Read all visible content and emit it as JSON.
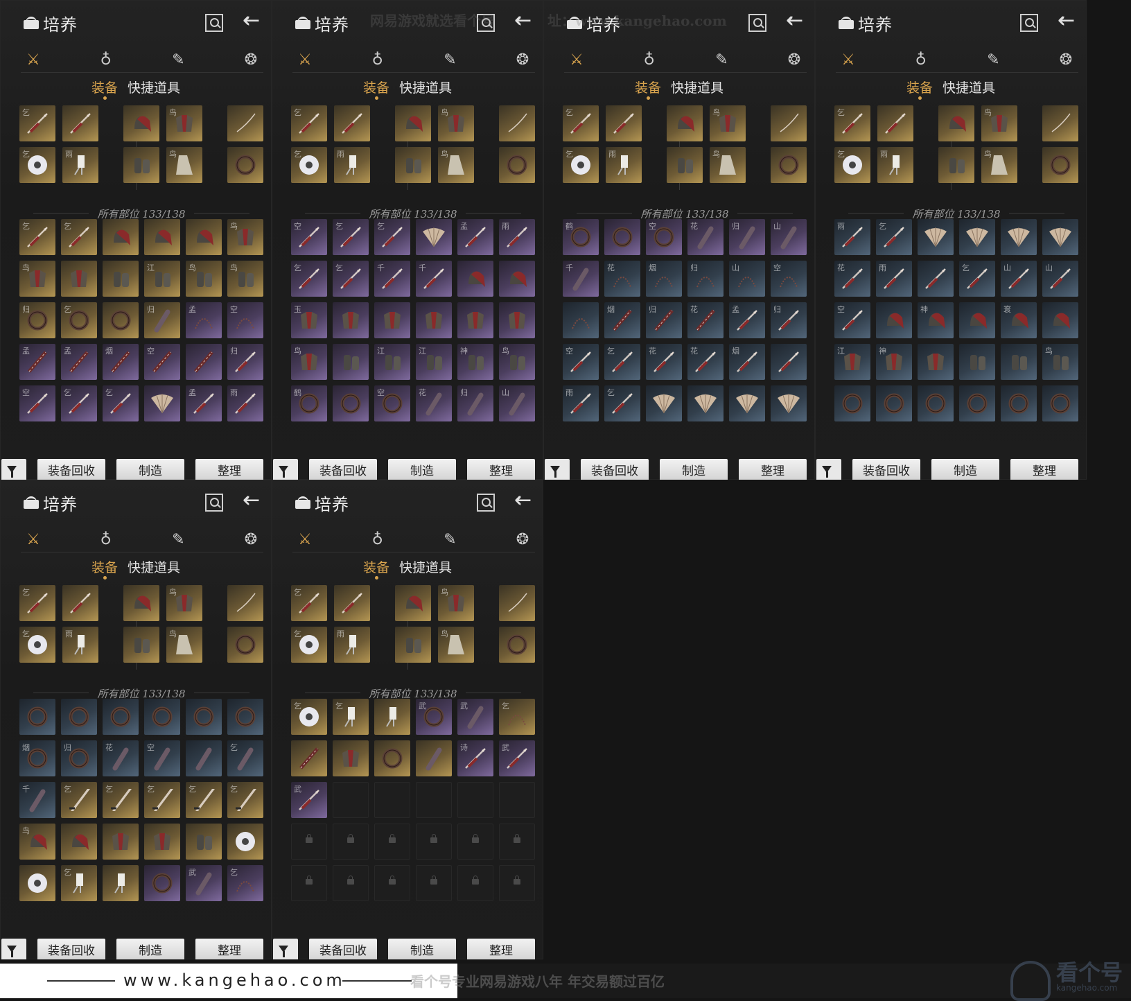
{
  "panel": {
    "title": "培养",
    "categories": [
      {
        "icon": "crossed-swords-icon",
        "glyph": "⚔",
        "active": true
      },
      {
        "icon": "pouch-icon",
        "glyph": "♁",
        "active": false
      },
      {
        "icon": "scroll-icon",
        "glyph": "✎",
        "active": false
      },
      {
        "icon": "skill-orb-icon",
        "glyph": "❂",
        "active": false
      }
    ],
    "tab_equip": "装备",
    "tab_quick": "快捷道具",
    "parts_label": "所有部位 133/138",
    "buttons": {
      "recycle": "装备回收",
      "craft": "制造",
      "arrange": "整理"
    }
  },
  "colors": {
    "accent": "#d9a44e",
    "gold": "#b49653",
    "purple": "#7f6a9e",
    "blue": "#52667a"
  },
  "equipped": [
    {
      "q": "gold",
      "ch": "乞",
      "type": "spear"
    },
    {
      "q": "gold",
      "ch": "",
      "type": "spear"
    },
    {
      "q": "gold",
      "ch": "",
      "type": "helmet"
    },
    {
      "q": "gold",
      "ch": "鸟",
      "type": "armor"
    },
    {
      "q": "gold",
      "ch": "",
      "type": "bow"
    },
    {
      "q": "gold",
      "ch": "乞",
      "type": "disc"
    },
    {
      "q": "gold",
      "ch": "雨",
      "type": "tassel"
    },
    {
      "q": "gold",
      "ch": "",
      "type": "bracer"
    },
    {
      "q": "gold",
      "ch": "鸟",
      "type": "boot"
    },
    {
      "q": "gold",
      "ch": "",
      "type": "ring"
    }
  ],
  "grids": [
    [
      [
        "gold",
        "乞",
        "spear"
      ],
      [
        "gold",
        "乞",
        "spear"
      ],
      [
        "gold",
        "",
        "helmet"
      ],
      [
        "gold",
        "",
        "helmet"
      ],
      [
        "gold",
        "",
        "helmet"
      ],
      [
        "gold",
        "鸟",
        "armor"
      ],
      [
        "gold",
        "鸟",
        "armor"
      ],
      [
        "gold",
        "",
        "armor"
      ],
      [
        "gold",
        "",
        "bracer"
      ],
      [
        "gold",
        "江",
        "bracer"
      ],
      [
        "gold",
        "鸟",
        "bracer"
      ],
      [
        "gold",
        "鸟",
        "bracer"
      ],
      [
        "gold",
        "归",
        "ring"
      ],
      [
        "gold",
        "乞",
        "ring"
      ],
      [
        "gold",
        "",
        "ring"
      ],
      [
        "gold",
        "归",
        "club"
      ],
      [
        "purple",
        "孟",
        "chain"
      ],
      [
        "purple",
        "空",
        "chain"
      ],
      [
        "purple",
        "孟",
        "umbrella"
      ],
      [
        "purple",
        "孟",
        "umbrella"
      ],
      [
        "purple",
        "烟",
        "umbrella"
      ],
      [
        "purple",
        "空",
        "umbrella"
      ],
      [
        "purple",
        "",
        "umbrella"
      ],
      [
        "purple",
        "归",
        "spear"
      ],
      [
        "purple",
        "空",
        "spear"
      ],
      [
        "purple",
        "乞",
        "spear"
      ],
      [
        "purple",
        "乞",
        "spear"
      ],
      [
        "purple",
        "",
        "fan"
      ],
      [
        "purple",
        "孟",
        "spear"
      ],
      [
        "purple",
        "雨",
        "spear"
      ]
    ],
    [
      [
        "purple",
        "空",
        "spear"
      ],
      [
        "purple",
        "乞",
        "spear"
      ],
      [
        "purple",
        "乞",
        "spear"
      ],
      [
        "purple",
        "",
        "fan"
      ],
      [
        "purple",
        "孟",
        "spear"
      ],
      [
        "purple",
        "雨",
        "spear"
      ],
      [
        "purple",
        "乞",
        "spear"
      ],
      [
        "purple",
        "乞",
        "spear"
      ],
      [
        "purple",
        "千",
        "spear"
      ],
      [
        "purple",
        "千",
        "spear"
      ],
      [
        "purple",
        "",
        "helmet"
      ],
      [
        "purple",
        "",
        "helmet"
      ],
      [
        "purple",
        "玉",
        "armor"
      ],
      [
        "purple",
        "",
        "armor"
      ],
      [
        "purple",
        "",
        "armor"
      ],
      [
        "purple",
        "",
        "armor"
      ],
      [
        "purple",
        "",
        "armor"
      ],
      [
        "purple",
        "",
        "armor"
      ],
      [
        "purple",
        "鸟",
        "armor"
      ],
      [
        "purple",
        "",
        "bracer"
      ],
      [
        "purple",
        "江",
        "bracer"
      ],
      [
        "purple",
        "江",
        "bracer"
      ],
      [
        "purple",
        "神",
        "bracer"
      ],
      [
        "purple",
        "鸟",
        "bracer"
      ],
      [
        "purple",
        "鹤",
        "ring"
      ],
      [
        "purple",
        "",
        "ring"
      ],
      [
        "purple",
        "空",
        "ring"
      ],
      [
        "purple",
        "花",
        "club"
      ],
      [
        "purple",
        "归",
        "club"
      ],
      [
        "purple",
        "山",
        "club"
      ]
    ],
    [
      [
        "purple",
        "鹤",
        "ring"
      ],
      [
        "purple",
        "",
        "ring"
      ],
      [
        "purple",
        "空",
        "ring"
      ],
      [
        "purple",
        "花",
        "club"
      ],
      [
        "purple",
        "归",
        "club"
      ],
      [
        "purple",
        "山",
        "club"
      ],
      [
        "purple",
        "千",
        "club"
      ],
      [
        "blue",
        "花",
        "chain"
      ],
      [
        "blue",
        "烟",
        "chain"
      ],
      [
        "blue",
        "归",
        "chain"
      ],
      [
        "blue",
        "山",
        "chain"
      ],
      [
        "blue",
        "空",
        "chain"
      ],
      [
        "blue",
        "",
        "chain"
      ],
      [
        "blue",
        "烟",
        "umbrella"
      ],
      [
        "blue",
        "归",
        "umbrella"
      ],
      [
        "blue",
        "花",
        "umbrella"
      ],
      [
        "blue",
        "孟",
        "spear"
      ],
      [
        "blue",
        "归",
        "spear"
      ],
      [
        "blue",
        "空",
        "spear"
      ],
      [
        "blue",
        "乞",
        "spear"
      ],
      [
        "blue",
        "花",
        "spear"
      ],
      [
        "blue",
        "花",
        "spear"
      ],
      [
        "blue",
        "烟",
        "spear"
      ],
      [
        "blue",
        "",
        "spear"
      ],
      [
        "blue",
        "雨",
        "spear"
      ],
      [
        "blue",
        "乞",
        "spear"
      ],
      [
        "blue",
        "",
        "fan"
      ],
      [
        "blue",
        "",
        "fan"
      ],
      [
        "blue",
        "",
        "fan"
      ],
      [
        "blue",
        "",
        "fan"
      ]
    ],
    [
      [
        "blue",
        "雨",
        "spear"
      ],
      [
        "blue",
        "乞",
        "spear"
      ],
      [
        "blue",
        "",
        "fan"
      ],
      [
        "blue",
        "",
        "fan"
      ],
      [
        "blue",
        "",
        "fan"
      ],
      [
        "blue",
        "",
        "fan"
      ],
      [
        "blue",
        "花",
        "spear"
      ],
      [
        "blue",
        "雨",
        "spear"
      ],
      [
        "blue",
        "",
        "spear"
      ],
      [
        "blue",
        "乞",
        "spear"
      ],
      [
        "blue",
        "山",
        "spear"
      ],
      [
        "blue",
        "山",
        "spear"
      ],
      [
        "blue",
        "空",
        "spear"
      ],
      [
        "blue",
        "",
        "helmet"
      ],
      [
        "blue",
        "神",
        "helmet"
      ],
      [
        "blue",
        "",
        "helmet"
      ],
      [
        "blue",
        "寰",
        "helmet"
      ],
      [
        "blue",
        "",
        "helmet"
      ],
      [
        "blue",
        "江",
        "armor"
      ],
      [
        "blue",
        "神",
        "armor"
      ],
      [
        "blue",
        "",
        "armor"
      ],
      [
        "blue",
        "",
        "bracer"
      ],
      [
        "blue",
        "",
        "bracer"
      ],
      [
        "blue",
        "鸟",
        "bracer"
      ],
      [
        "blue",
        "",
        "ring"
      ],
      [
        "blue",
        "",
        "ring"
      ],
      [
        "blue",
        "",
        "ring"
      ],
      [
        "blue",
        "",
        "ring"
      ],
      [
        "blue",
        "",
        "ring"
      ],
      [
        "blue",
        "",
        "ring"
      ]
    ],
    [
      [
        "blue",
        "",
        "ring"
      ],
      [
        "blue",
        "",
        "ring"
      ],
      [
        "blue",
        "",
        "ring"
      ],
      [
        "blue",
        "",
        "ring"
      ],
      [
        "blue",
        "",
        "ring"
      ],
      [
        "blue",
        "",
        "ring"
      ],
      [
        "blue",
        "烟",
        "ring"
      ],
      [
        "blue",
        "归",
        "ring"
      ],
      [
        "blue",
        "花",
        "club"
      ],
      [
        "blue",
        "空",
        "club"
      ],
      [
        "blue",
        "",
        "club"
      ],
      [
        "blue",
        "乞",
        "club"
      ],
      [
        "blue",
        "千",
        "club"
      ],
      [
        "gold",
        "乞",
        "blade"
      ],
      [
        "gold",
        "乞",
        "blade"
      ],
      [
        "gold",
        "乞",
        "blade"
      ],
      [
        "gold",
        "乞",
        "blade"
      ],
      [
        "gold",
        "乞",
        "blade"
      ],
      [
        "gold",
        "鸟",
        "helmet"
      ],
      [
        "gold",
        "",
        "helmet"
      ],
      [
        "gold",
        "",
        "armor"
      ],
      [
        "gold",
        "",
        "armor"
      ],
      [
        "gold",
        "",
        "bracer"
      ],
      [
        "gold",
        "",
        "disc"
      ],
      [
        "gold",
        "",
        "disc"
      ],
      [
        "gold",
        "乞",
        "tassel"
      ],
      [
        "gold",
        "",
        "tassel"
      ],
      [
        "purple",
        "",
        "ring"
      ],
      [
        "purple",
        "武",
        "club"
      ],
      [
        "purple",
        "乞",
        "chain"
      ]
    ],
    [
      [
        "gold",
        "乞",
        "disc"
      ],
      [
        "gold",
        "乞",
        "tassel"
      ],
      [
        "gold",
        "",
        "tassel"
      ],
      [
        "purple",
        "武",
        "ring"
      ],
      [
        "purple",
        "武",
        "club"
      ],
      [
        "gold",
        "乞",
        "chain"
      ],
      [
        "gold",
        "",
        "umbrella"
      ],
      [
        "gold",
        "",
        "armor"
      ],
      [
        "gold",
        "",
        "ring"
      ],
      [
        "gold",
        "",
        "club"
      ],
      [
        "purple",
        "诗",
        "spear"
      ],
      [
        "purple",
        "武",
        "spear"
      ],
      [
        "purple",
        "武",
        "spear"
      ],
      [
        "empty",
        "",
        ""
      ],
      [
        "empty",
        "",
        ""
      ],
      [
        "empty",
        "",
        ""
      ],
      [
        "empty",
        "",
        ""
      ],
      [
        "empty",
        "",
        ""
      ],
      [
        "empty",
        "",
        "lock"
      ],
      [
        "empty",
        "",
        "lock"
      ],
      [
        "empty",
        "",
        "lock"
      ],
      [
        "empty",
        "",
        "lock"
      ],
      [
        "empty",
        "",
        "lock"
      ],
      [
        "empty",
        "",
        "lock"
      ],
      [
        "empty",
        "",
        "lock"
      ],
      [
        "empty",
        "",
        "lock"
      ],
      [
        "empty",
        "",
        "lock"
      ],
      [
        "empty",
        "",
        "lock"
      ],
      [
        "empty",
        "",
        "lock"
      ],
      [
        "empty",
        "",
        "lock"
      ]
    ]
  ],
  "watermarks": {
    "top": "网易游戏就选看个号",
    "site_mid": "址：www.kangehao.com"
  },
  "footer": {
    "site": "www.kangehao.com",
    "slogan": "看个号专业网易游戏八年  年交易额过百亿",
    "brand": "看个号",
    "brand_url": "kangehao.com"
  }
}
